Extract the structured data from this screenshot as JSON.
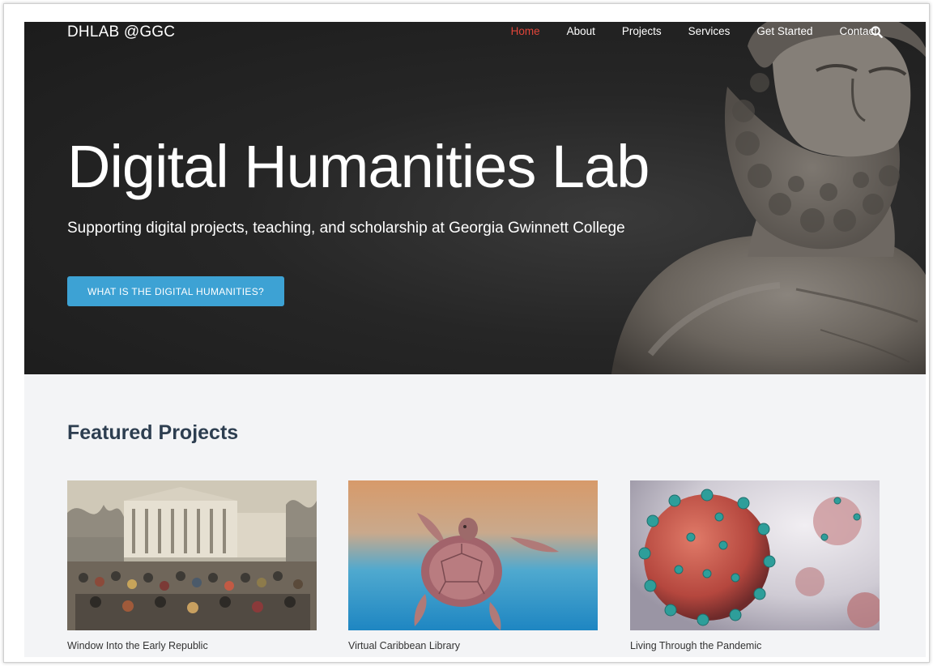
{
  "header": {
    "brand": "DHLAB @GGC",
    "nav": [
      "Home",
      "About",
      "Projects",
      "Services",
      "Get Started",
      "Contact"
    ],
    "active_nav": "Home",
    "search_icon": "search-icon"
  },
  "hero": {
    "title": "Digital Humanities Lab",
    "subtitle": "Supporting digital projects, teaching, and scholarship at Georgia Gwinnett College",
    "cta_label": "WHAT IS THE DIGITAL HUMANITIES?"
  },
  "featured": {
    "heading": "Featured Projects",
    "projects": [
      {
        "title": "Window Into the Early Republic"
      },
      {
        "title": "Virtual Caribbean Library"
      },
      {
        "title": "Living Through the Pandemic"
      }
    ]
  },
  "colors": {
    "accent": "#3da2d4",
    "active_nav": "#e0453a",
    "hero_bg": "#262626",
    "section_bg": "#f3f4f6",
    "heading": "#2d3e50"
  }
}
